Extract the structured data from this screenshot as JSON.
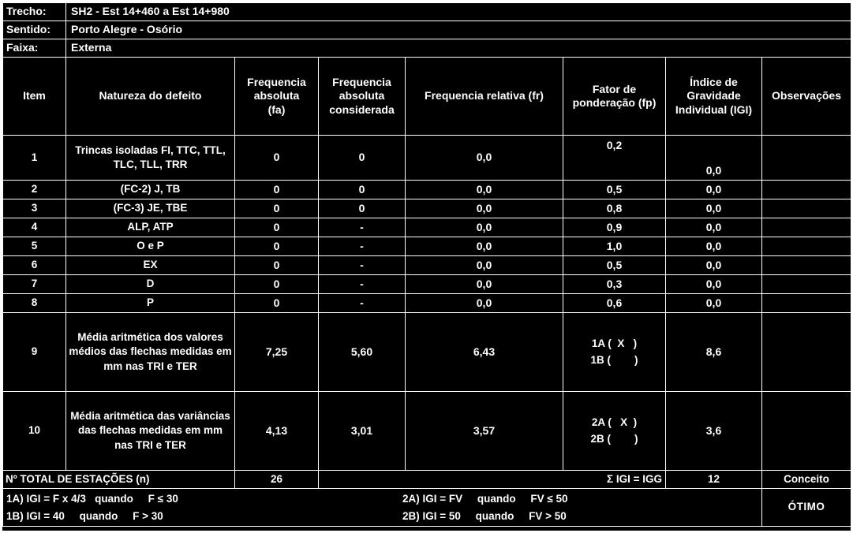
{
  "info": [
    {
      "label": "Trecho:",
      "value": "SH2 - Est 14+460 a  Est 14+980"
    },
    {
      "label": "Sentido:",
      "value": "Porto Alegre - Osório"
    },
    {
      "label": "Faixa:",
      "value": "Externa"
    }
  ],
  "columns": {
    "item": "Item",
    "natureza": "Natureza do defeito",
    "fa": "Frequencia\nabsoluta\n(fa)",
    "fa_l1": "Frequencia",
    "fa_l2": "absoluta",
    "fa_l3": "(fa)",
    "fac_l1": "Frequencia",
    "fac_l2": "absoluta",
    "fac_l3": "considerada",
    "fr": "Frequencia relativa   (fr)",
    "fp_l1": "Fator de",
    "fp_l2": "ponderação (fp)",
    "igi_l1": "Índice de",
    "igi_l2": "Gravidade",
    "igi_l3": "Individual (IGI)",
    "obs": "Observações"
  },
  "rows": [
    {
      "item": "1",
      "natureza": "Trincas isoladas FI, TTC, TTL, TLC, TLL, TRR",
      "fa": "0",
      "fac": "0",
      "fr": "0,0",
      "fp": "0,2",
      "igi": "0,0",
      "obs": ""
    },
    {
      "item": "2",
      "natureza": "(FC-2) J, TB",
      "fa": "0",
      "fac": "0",
      "fr": "0,0",
      "fp": "0,5",
      "igi": "0,0",
      "obs": ""
    },
    {
      "item": "3",
      "natureza": "(FC-3) JE, TBE",
      "fa": "0",
      "fac": "0",
      "fr": "0,0",
      "fp": "0,8",
      "igi": "0,0",
      "obs": ""
    },
    {
      "item": "4",
      "natureza": "ALP, ATP",
      "fa": "0",
      "fac": "-",
      "fr": "0,0",
      "fp": "0,9",
      "igi": "0,0",
      "obs": ""
    },
    {
      "item": "5",
      "natureza": "O e P",
      "fa": "0",
      "fac": "-",
      "fr": "0,0",
      "fp": "1,0",
      "igi": "0,0",
      "obs": ""
    },
    {
      "item": "6",
      "natureza": "EX",
      "fa": "0",
      "fac": "-",
      "fr": "0,0",
      "fp": "0,5",
      "igi": "0,0",
      "obs": ""
    },
    {
      "item": "7",
      "natureza": "D",
      "fa": "0",
      "fac": "-",
      "fr": "0,0",
      "fp": "0,3",
      "igi": "0,0",
      "obs": ""
    },
    {
      "item": "8",
      "natureza": "P",
      "fa": "0",
      "fac": "-",
      "fr": "0,0",
      "fp": "0,6",
      "igi": "0,0",
      "obs": ""
    },
    {
      "item": "9",
      "natureza": "Média aritmética dos valores médios das flechas medidas em mm nas TRI e TER",
      "fa": "7,25",
      "fac": "5,60",
      "fr": "6,43",
      "fp_a": "1A (  X   )",
      "fp_b": "1B (        )",
      "igi": "8,6",
      "obs": ""
    },
    {
      "item": "10",
      "natureza": "Média aritmética das variâncias das flechas medidas em mm nas TRI e TER",
      "fa": "4,13",
      "fac": "3,01",
      "fr": "3,57",
      "fp_a": "2A (   X  )",
      "fp_b": "2B (        )",
      "igi": "3,6",
      "obs": ""
    }
  ],
  "total": {
    "label": "Nº TOTAL DE ESTAÇÕES (n)",
    "n": "26",
    "sum_label": "Σ IGI = IGG",
    "igg": "12",
    "conceito_header": "Conceito"
  },
  "footer": {
    "formula_1a": "1A) IGI = F x 4/3   quando     F ≤ 30",
    "formula_1b": "1B) IGI = 40     quando     F > 30",
    "formula_2a": "2A) IGI = FV     quando     FV ≤ 50",
    "formula_2b": "2B) IGI = 50     quando     FV > 50",
    "conceito_value": "ÓTIMO"
  }
}
